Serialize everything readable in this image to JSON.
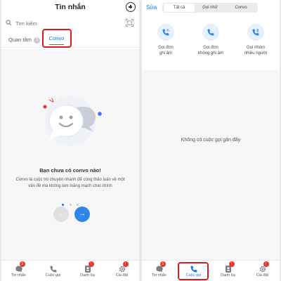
{
  "left": {
    "header": {
      "title": "Tin nhắn"
    },
    "search": {
      "placeholder": "Tìm kiếm"
    },
    "tabs": {
      "quantam": {
        "label": "Quan tâm",
        "count": "3"
      },
      "convo": {
        "label": "Convo"
      }
    },
    "empty_state": {
      "title": "Bạn chưa có convo nào!",
      "description": "Convo là cuộc trò chuyện nhanh để cùng thảo luận về một vấn đề mà không làm loãng mạch chat chính"
    },
    "pager": {
      "prev_symbol": "←",
      "next_symbol": "→"
    }
  },
  "right": {
    "header": {
      "edit_label": "Sửa",
      "segments": [
        "Tất cả",
        "Gọi nhỡ",
        "Convo"
      ],
      "active_segment": "Tất cả"
    },
    "call_types": [
      {
        "label": "Gọi đơn\nghi âm",
        "icon": "phone-record-icon"
      },
      {
        "label": "Gọi đơn\nkhông ghi âm",
        "icon": "phone-icon"
      },
      {
        "label": "Gọi nhóm\nnhiều người",
        "icon": "group-call-icon"
      }
    ],
    "empty_text": "Không có cuộc gọi gần đây"
  },
  "nav": {
    "items": [
      {
        "label": "Tin nhắn",
        "icon": "chat-icon",
        "badge": "3"
      },
      {
        "label": "Cuộc gọi",
        "icon": "phone-icon"
      },
      {
        "label": "Danh bạ",
        "icon": "contacts-icon",
        "badge": "!"
      },
      {
        "label": "Cài đặt",
        "icon": "gear-icon",
        "badge": "!"
      }
    ]
  },
  "colors": {
    "accent": "#1a73e8",
    "highlight_box": "#e11a22",
    "badge": "#e8362e"
  }
}
